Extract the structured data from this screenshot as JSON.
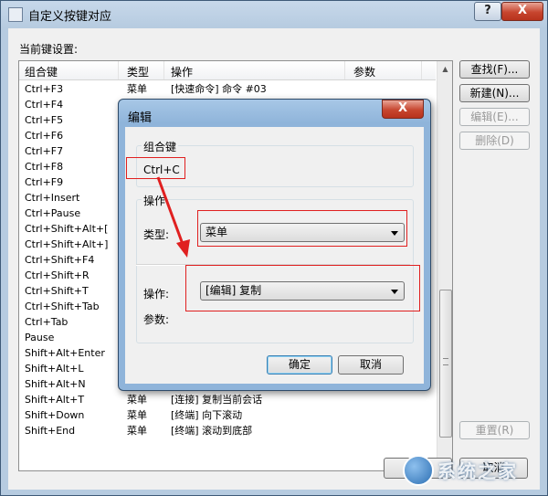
{
  "window": {
    "title": "自定义按键对应",
    "help_label": "?",
    "close_label": "X"
  },
  "main": {
    "current_settings_label": "当前键设置:",
    "columns": [
      "组合键",
      "类型",
      "操作",
      "参数"
    ],
    "rows": [
      {
        "key": "Ctrl+F3",
        "type": "菜单",
        "action": "[快速命令] 命令 #03"
      },
      {
        "key": "Ctrl+F4",
        "type": "",
        "action": ""
      },
      {
        "key": "Ctrl+F5",
        "type": "",
        "action": ""
      },
      {
        "key": "Ctrl+F6",
        "type": "",
        "action": ""
      },
      {
        "key": "Ctrl+F7",
        "type": "",
        "action": ""
      },
      {
        "key": "Ctrl+F8",
        "type": "",
        "action": ""
      },
      {
        "key": "Ctrl+F9",
        "type": "",
        "action": ""
      },
      {
        "key": "Ctrl+Insert",
        "type": "",
        "action": ""
      },
      {
        "key": "Ctrl+Pause",
        "type": "",
        "action": ""
      },
      {
        "key": "Ctrl+Shift+Alt+[",
        "type": "",
        "action": ""
      },
      {
        "key": "Ctrl+Shift+Alt+]",
        "type": "",
        "action": ""
      },
      {
        "key": "Ctrl+Shift+F4",
        "type": "",
        "action": ""
      },
      {
        "key": "Ctrl+Shift+R",
        "type": "",
        "action": ""
      },
      {
        "key": "Ctrl+Shift+T",
        "type": "",
        "action": ""
      },
      {
        "key": "Ctrl+Shift+Tab",
        "type": "",
        "action": ""
      },
      {
        "key": "Ctrl+Tab",
        "type": "",
        "action": ""
      },
      {
        "key": "Pause",
        "type": "",
        "action": ""
      },
      {
        "key": "Shift+Alt+Enter",
        "type": "",
        "action": ""
      },
      {
        "key": "Shift+Alt+L",
        "type": "",
        "action": ""
      },
      {
        "key": "Shift+Alt+N",
        "type": "",
        "action": ""
      },
      {
        "key": "Shift+Alt+T",
        "type": "菜单",
        "action": "[连接] 复制当前会话"
      },
      {
        "key": "Shift+Down",
        "type": "菜单",
        "action": "[终端] 向下滚动"
      },
      {
        "key": "Shift+End",
        "type": "菜单",
        "action": "[终端] 滚动到底部"
      }
    ],
    "buttons": {
      "find": "查找(F)...",
      "new": "新建(N)...",
      "edit": "编辑(E)...",
      "delete": "删除(D)",
      "reset": "重置(R)",
      "ok": "确 定",
      "cancel": "取消"
    }
  },
  "dialog": {
    "title": "编辑",
    "close_label": "X",
    "combo_group_label": "组合键",
    "combo_value": "Ctrl+C",
    "action_group_label": "操作",
    "type_label": "类型:",
    "type_value": "菜单",
    "action_label": "操作:",
    "action_value": "[编辑] 复制",
    "param_label": "参数:",
    "ok_label": "确定",
    "cancel_label": "取消"
  },
  "watermark": {
    "text": "系统之家"
  },
  "colors": {
    "highlight": "#e02020",
    "accent": "#3c7fb1"
  }
}
